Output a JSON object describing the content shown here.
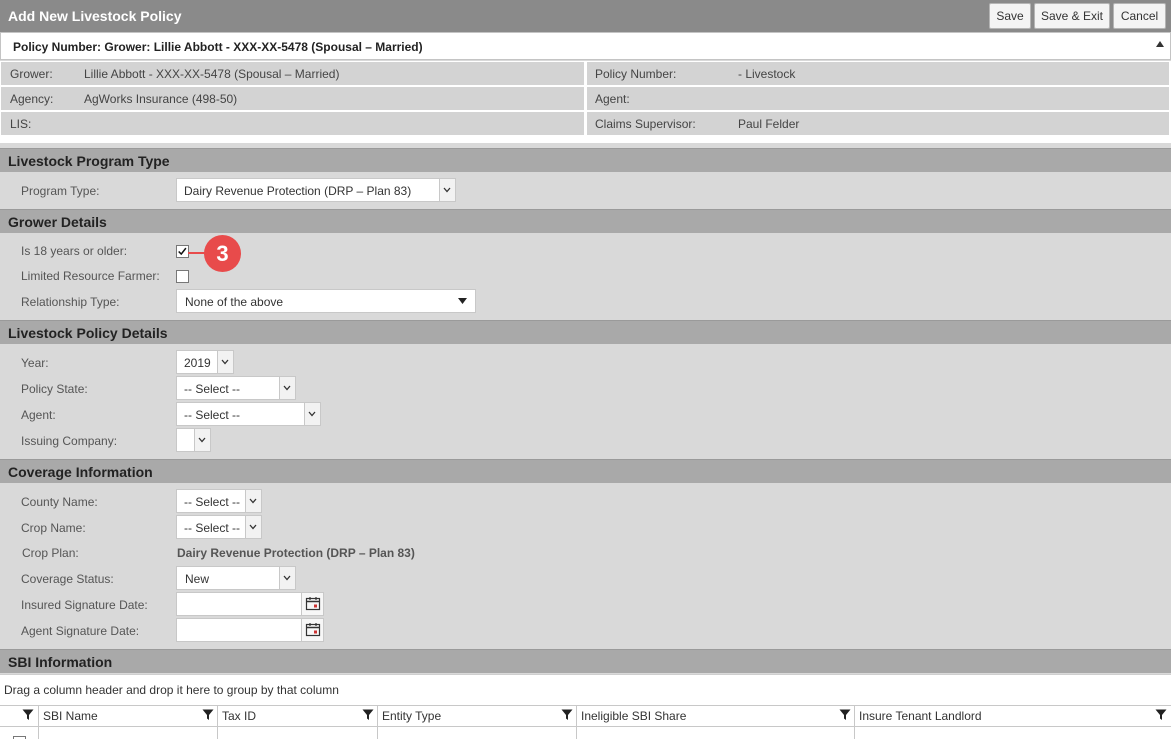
{
  "window": {
    "title": "Add New Livestock Policy",
    "buttons": {
      "save": "Save",
      "save_exit": "Save & Exit",
      "cancel": "Cancel"
    }
  },
  "policy_header": "Policy Number: Grower: Lillie Abbott - XXX-XX-5478 (Spousal – Married)",
  "info": {
    "grower_label": "Grower:",
    "grower_value": "Lillie Abbott - XXX-XX-5478 (Spousal – Married)",
    "agency_label": "Agency:",
    "agency_value": "AgWorks Insurance (498-50)",
    "lis_label": "LIS:",
    "policy_number_label": "Policy Number:",
    "policy_number_value": "- Livestock",
    "agent_label": "Agent:",
    "claims_label": "Claims Supervisor:",
    "claims_value": "Paul Felder"
  },
  "program": {
    "header": "Livestock Program Type",
    "program_type_label": "Program Type:",
    "program_type_value": "Dairy Revenue Protection (DRP – Plan 83)"
  },
  "grower": {
    "header": "Grower Details",
    "age_label": "Is 18 years or older:",
    "age_checked": true,
    "limited_label": "Limited Resource Farmer:",
    "limited_checked": false,
    "relationship_label": "Relationship Type:",
    "relationship_value": "None of the above"
  },
  "callout": "3",
  "policy_details": {
    "header": "Livestock Policy Details",
    "year_label": "Year:",
    "year_value": "2019",
    "state_label": "Policy State:",
    "state_value": "-- Select --",
    "agent_label": "Agent:",
    "agent_value": "-- Select --",
    "issuing_label": "Issuing Company:",
    "issuing_value": ""
  },
  "coverage": {
    "header": "Coverage Information",
    "county_label": "County Name:",
    "county_value": "-- Select --",
    "crop_label": "Crop Name:",
    "crop_value": "-- Select --",
    "plan_label": "Crop Plan:",
    "plan_value": "Dairy Revenue Protection (DRP – Plan 83)",
    "status_label": "Coverage Status:",
    "status_value": "New",
    "insured_sig_label": "Insured Signature Date:",
    "agent_sig_label": "Agent Signature Date:"
  },
  "sbi": {
    "header": "SBI Information",
    "group_hint": "Drag a column header and drop it here to group by that column",
    "columns": [
      "SBI Name",
      "Tax ID",
      "Entity Type",
      "Ineligible SBI Share",
      "Insure Tenant Landlord"
    ]
  },
  "icons": {
    "dropdown": "chevron-down-icon",
    "calendar": "calendar-icon",
    "filter": "filter-icon",
    "collapse": "caret-up-icon"
  },
  "colors": {
    "callout": "#e84b4b",
    "titlebar": "#8a8a8a",
    "section": "#a9a9a9"
  }
}
